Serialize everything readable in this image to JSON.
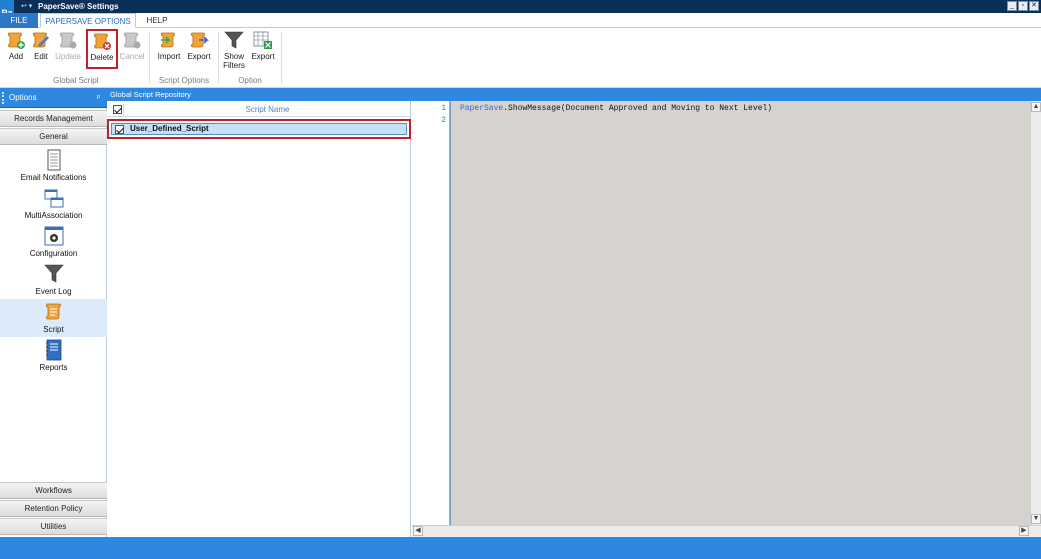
{
  "window": {
    "title": "PaperSave® Settings",
    "app_icon_text": "Pa",
    "quick_access": "↩ ▾",
    "controls": [
      "_",
      "▫",
      "✕"
    ]
  },
  "tabs": [
    {
      "label": "FILE"
    },
    {
      "label": "PAPERSAVE OPTIONS"
    },
    {
      "label": "HELP"
    }
  ],
  "ribbon": {
    "groups": [
      {
        "label": "Global Script"
      },
      {
        "label": "Script Options"
      },
      {
        "label": "Option"
      }
    ],
    "buttons": [
      {
        "label": "Add",
        "icon": "script-add-icon",
        "enabled": true
      },
      {
        "label": "Edit",
        "icon": "script-edit-icon",
        "enabled": true
      },
      {
        "label": "Update",
        "icon": "script-update-icon",
        "enabled": false
      },
      {
        "label": "Delete",
        "icon": "script-delete-icon",
        "enabled": true,
        "selected": true
      },
      {
        "label": "Cancel",
        "icon": "script-cancel-icon",
        "enabled": false
      },
      {
        "label": "Import",
        "icon": "script-import-icon",
        "enabled": true
      },
      {
        "label": "Export",
        "icon": "script-export-icon",
        "enabled": true
      },
      {
        "label": "Show\nFilters",
        "label_line1": "Show",
        "label_line2": "Filters",
        "icon": "filter-icon",
        "enabled": true
      },
      {
        "label": "Export",
        "icon": "grid-export-icon",
        "enabled": true
      }
    ]
  },
  "sidebar": {
    "header": "Options",
    "pin": "ᵖ",
    "sections_top": [
      {
        "label": "Records Management"
      },
      {
        "label": "General"
      }
    ],
    "items": [
      {
        "label": "Email Notifications",
        "icon": "document-icon"
      },
      {
        "label": "MultiAssociation",
        "icon": "windows-icon"
      },
      {
        "label": "Configuration",
        "icon": "gear-icon"
      },
      {
        "label": "Event Log",
        "icon": "funnel-icon"
      },
      {
        "label": "Script",
        "icon": "scroll-icon",
        "active": true
      },
      {
        "label": "Reports",
        "icon": "notebook-icon"
      }
    ],
    "sections_bottom": [
      {
        "label": "Workflows"
      },
      {
        "label": "Retention Policy"
      },
      {
        "label": "Utilities"
      }
    ]
  },
  "repository": {
    "title": "Global Script Repository",
    "column_header": "Script Name",
    "rows": [
      {
        "name": "User_Defined_Script",
        "checked": true,
        "selected": true
      }
    ]
  },
  "editor": {
    "line_numbers": [
      "1",
      "2"
    ],
    "code": {
      "object": "PaperSave",
      "rest": ".ShowMessage(Document Approved and Moving to Next Level)"
    }
  },
  "colors": {
    "accent": "#2f88e0",
    "title_bar": "#0b2f57",
    "highlight": "#c0202a"
  }
}
